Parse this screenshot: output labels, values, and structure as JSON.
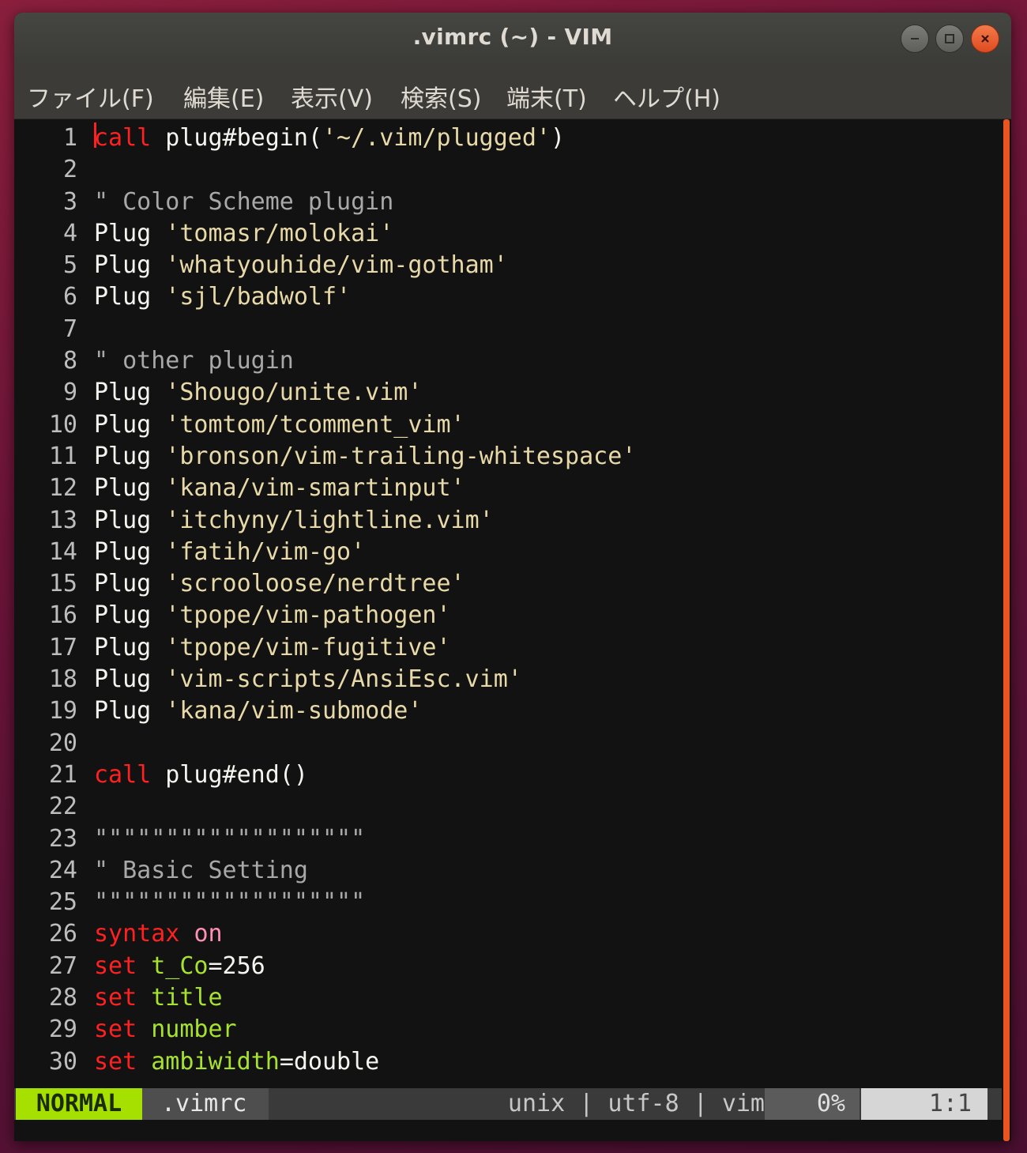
{
  "window": {
    "title": ".vimrc (~) - VIM"
  },
  "menu": [
    {
      "label": "ファイル(F)"
    },
    {
      "label": "編集(E)"
    },
    {
      "label": "表示(V)"
    },
    {
      "label": "検索(S)"
    },
    {
      "label": "端末(T)"
    },
    {
      "label": "ヘルプ(H)"
    }
  ],
  "editor": {
    "lines": [
      {
        "num": "1",
        "tokens": [
          {
            "t": "call",
            "k": "kw"
          },
          {
            "t": " plug#begin(",
            "k": "id"
          },
          {
            "t": "'~/.vim/plugged'",
            "k": "str"
          },
          {
            "t": ")",
            "k": "id"
          }
        ]
      },
      {
        "num": "2",
        "tokens": []
      },
      {
        "num": "3",
        "tokens": [
          {
            "t": "\" Color Scheme plugin",
            "k": "cmt"
          }
        ]
      },
      {
        "num": "4",
        "tokens": [
          {
            "t": "Plug ",
            "k": "id"
          },
          {
            "t": "'tomasr/molokai'",
            "k": "str"
          }
        ]
      },
      {
        "num": "5",
        "tokens": [
          {
            "t": "Plug ",
            "k": "id"
          },
          {
            "t": "'whatyouhide/vim-gotham'",
            "k": "str"
          }
        ]
      },
      {
        "num": "6",
        "tokens": [
          {
            "t": "Plug ",
            "k": "id"
          },
          {
            "t": "'sjl/badwolf'",
            "k": "str"
          }
        ]
      },
      {
        "num": "7",
        "tokens": []
      },
      {
        "num": "8",
        "tokens": [
          {
            "t": "\" other plugin",
            "k": "cmt"
          }
        ]
      },
      {
        "num": "9",
        "tokens": [
          {
            "t": "Plug ",
            "k": "id"
          },
          {
            "t": "'Shougo/unite.vim'",
            "k": "str"
          }
        ]
      },
      {
        "num": "10",
        "tokens": [
          {
            "t": "Plug ",
            "k": "id"
          },
          {
            "t": "'tomtom/tcomment_vim'",
            "k": "str"
          }
        ]
      },
      {
        "num": "11",
        "tokens": [
          {
            "t": "Plug ",
            "k": "id"
          },
          {
            "t": "'bronson/vim-trailing-whitespace'",
            "k": "str"
          }
        ]
      },
      {
        "num": "12",
        "tokens": [
          {
            "t": "Plug ",
            "k": "id"
          },
          {
            "t": "'kana/vim-smartinput'",
            "k": "str"
          }
        ]
      },
      {
        "num": "13",
        "tokens": [
          {
            "t": "Plug ",
            "k": "id"
          },
          {
            "t": "'itchyny/lightline.vim'",
            "k": "str"
          }
        ]
      },
      {
        "num": "14",
        "tokens": [
          {
            "t": "Plug ",
            "k": "id"
          },
          {
            "t": "'fatih/vim-go'",
            "k": "str"
          }
        ]
      },
      {
        "num": "15",
        "tokens": [
          {
            "t": "Plug ",
            "k": "id"
          },
          {
            "t": "'scrooloose/nerdtree'",
            "k": "str"
          }
        ]
      },
      {
        "num": "16",
        "tokens": [
          {
            "t": "Plug ",
            "k": "id"
          },
          {
            "t": "'tpope/vim-pathogen'",
            "k": "str"
          }
        ]
      },
      {
        "num": "17",
        "tokens": [
          {
            "t": "Plug ",
            "k": "id"
          },
          {
            "t": "'tpope/vim-fugitive'",
            "k": "str"
          }
        ]
      },
      {
        "num": "18",
        "tokens": [
          {
            "t": "Plug ",
            "k": "id"
          },
          {
            "t": "'vim-scripts/AnsiEsc.vim'",
            "k": "str"
          }
        ]
      },
      {
        "num": "19",
        "tokens": [
          {
            "t": "Plug ",
            "k": "id"
          },
          {
            "t": "'kana/vim-submode'",
            "k": "str"
          }
        ]
      },
      {
        "num": "20",
        "tokens": []
      },
      {
        "num": "21",
        "tokens": [
          {
            "t": "call",
            "k": "kw"
          },
          {
            "t": " plug#end()",
            "k": "id"
          }
        ]
      },
      {
        "num": "22",
        "tokens": []
      },
      {
        "num": "23",
        "tokens": [
          {
            "t": "\"\"\"\"\"\"\"\"\"\"\"\"\"\"\"\"\"\"\"",
            "k": "cmt"
          }
        ]
      },
      {
        "num": "24",
        "tokens": [
          {
            "t": "\" Basic Setting",
            "k": "cmt"
          }
        ]
      },
      {
        "num": "25",
        "tokens": [
          {
            "t": "\"\"\"\"\"\"\"\"\"\"\"\"\"\"\"\"\"\"\"",
            "k": "cmt"
          }
        ]
      },
      {
        "num": "26",
        "tokens": [
          {
            "t": "syntax",
            "k": "kw"
          },
          {
            "t": " ",
            "k": "id"
          },
          {
            "t": "on",
            "k": "val"
          }
        ]
      },
      {
        "num": "27",
        "tokens": [
          {
            "t": "set",
            "k": "kw"
          },
          {
            "t": " ",
            "k": "id"
          },
          {
            "t": "t_Co",
            "k": "opt"
          },
          {
            "t": "=256",
            "k": "num"
          }
        ]
      },
      {
        "num": "28",
        "tokens": [
          {
            "t": "set",
            "k": "kw"
          },
          {
            "t": " ",
            "k": "id"
          },
          {
            "t": "title",
            "k": "opt"
          }
        ]
      },
      {
        "num": "29",
        "tokens": [
          {
            "t": "set",
            "k": "kw"
          },
          {
            "t": " ",
            "k": "id"
          },
          {
            "t": "number",
            "k": "opt"
          }
        ]
      },
      {
        "num": "30",
        "tokens": [
          {
            "t": "set",
            "k": "kw"
          },
          {
            "t": " ",
            "k": "id"
          },
          {
            "t": "ambiwidth",
            "k": "opt"
          },
          {
            "t": "=double",
            "k": "id"
          }
        ]
      }
    ]
  },
  "statusline": {
    "mode": "NORMAL",
    "filename": ".vimrc",
    "info": "unix | utf-8 | vim",
    "percent": "0%",
    "position": "1:1"
  },
  "colors": {
    "accent": "#e95420",
    "mode_bg": "#a6e000",
    "keyword": "#ff2020",
    "string": "#e8d9a8",
    "comment": "#a8a8a8",
    "option": "#a6e22e"
  }
}
